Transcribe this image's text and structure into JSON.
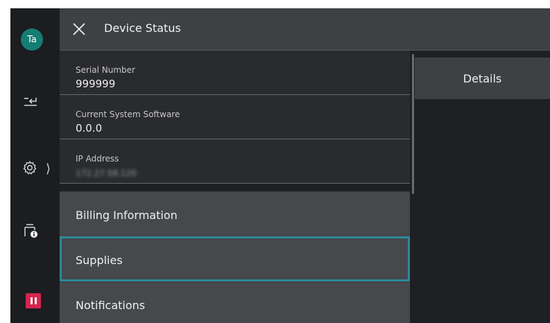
{
  "user": {
    "avatar_initials": "Ta"
  },
  "header": {
    "title": "Device Status"
  },
  "device_info": [
    {
      "label": "Serial Number",
      "value": "999999"
    },
    {
      "label": "Current System Software",
      "value": "0.0.0"
    },
    {
      "label": "IP Address",
      "value": "172.27.58.120"
    }
  ],
  "menu": {
    "items": [
      {
        "label": "Billing Information"
      },
      {
        "label": "Supplies",
        "selected": true
      },
      {
        "label": "Notifications"
      }
    ]
  },
  "right_panel": {
    "details_label": "Details"
  },
  "colors": {
    "accent": "#2a8a9a",
    "avatar": "#167c74",
    "pause_button": "#d6244e"
  },
  "icons": [
    "close-icon",
    "switch-user-icon",
    "settings-gear-icon",
    "printer-info-icon",
    "pause-icon"
  ]
}
